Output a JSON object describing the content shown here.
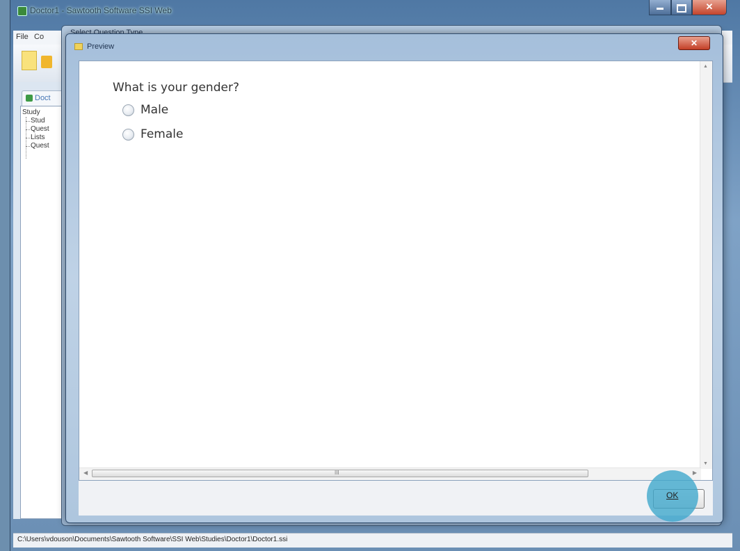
{
  "app": {
    "title": "Doctor1 - Sawtooth Software SSI Web",
    "menu": [
      "File",
      "Co"
    ],
    "left_tab_label": "Doct",
    "tree": {
      "root": "Study",
      "items": [
        "Stud",
        "Quest",
        "Lists",
        "Quest"
      ]
    },
    "status_path": "C:\\Users\\vdouson\\Documents\\Sawtooth Software\\SSI Web\\Studies\\Doctor1\\Doctor1.ssi"
  },
  "background_dialog": {
    "title": "Select Question Type"
  },
  "preview": {
    "title": "Preview",
    "question": "What is your gender?",
    "options": [
      "Male",
      "Female"
    ],
    "hscroll_grip": "III",
    "ok_label": "OK"
  }
}
